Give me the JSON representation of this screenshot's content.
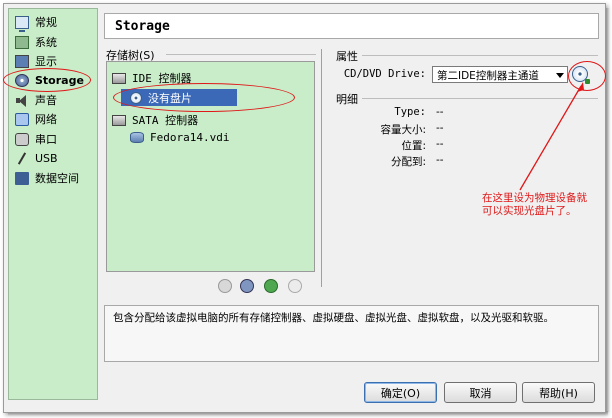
{
  "sidebar": {
    "items": [
      {
        "label": "常规",
        "icon": "monitor-icon"
      },
      {
        "label": "系统",
        "icon": "chip-icon"
      },
      {
        "label": "显示",
        "icon": "screen-icon"
      },
      {
        "label": "Storage",
        "icon": "disk-icon",
        "selected": true
      },
      {
        "label": "声音",
        "icon": "speaker-icon"
      },
      {
        "label": "网络",
        "icon": "network-icon"
      },
      {
        "label": "串口",
        "icon": "serial-port-icon"
      },
      {
        "label": "USB",
        "icon": "usb-icon"
      },
      {
        "label": "数据空间",
        "icon": "folder-icon"
      }
    ]
  },
  "page": {
    "title": "Storage"
  },
  "tree": {
    "label": "存储树",
    "shortcut": "(S)",
    "ide_controller": "IDE 控制器",
    "empty_disc": "没有盘片",
    "sata_controller": "SATA 控制器",
    "vdi": "Fedora14.vdi"
  },
  "attributes": {
    "header": "属性",
    "drive_label": "CD/DVD Drive:",
    "drive_value": "第二IDE控制器主通道"
  },
  "details": {
    "header": "明细",
    "type_label": "Type:",
    "type_value": "--",
    "size_label": "容量大小:",
    "size_value": "--",
    "location_label": "位置:",
    "location_value": "--",
    "attached_label": "分配到:",
    "attached_value": "--"
  },
  "annotation": {
    "line1": "在这里设为物理设备就",
    "line2": "可以实现光盘片了。"
  },
  "description": "包含分配给该虚拟电脑的所有存储控制器、虚拟硬盘、虚拟光盘、虚拟软盘，以及光驱和软驱。",
  "buttons": {
    "ok": "确定(O)",
    "cancel": "取消",
    "help": "帮助(H)"
  },
  "colors": {
    "panel_green": "#c9ecc9",
    "selection_blue": "#3b69b8",
    "annotation_red": "#e01818"
  }
}
